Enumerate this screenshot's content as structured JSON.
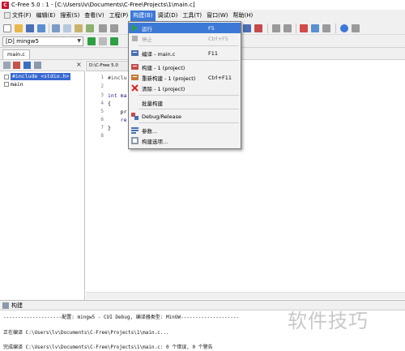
{
  "window": {
    "title": "C-Free 5.0 : 1 - [C:\\Users\\lv\\Documents\\C-Free\\Projects\\1\\main.c]"
  },
  "menubar": {
    "items": [
      "文件(F)",
      "编辑(E)",
      "搜索(S)",
      "查看(V)",
      "工程(P)",
      "构建(B)",
      "调试(D)",
      "工具(T)",
      "窗口(W)",
      "帮助(H)"
    ],
    "active": "构建(B)"
  },
  "toolbar": {
    "target": "[D] mingw5"
  },
  "file_tab": "main.c",
  "project_tree": {
    "items": [
      "#include <stdio.h>",
      "main"
    ]
  },
  "editor": {
    "tab_title": "D:\\C-Free 5.0",
    "line_numbers": [
      "1",
      "2",
      "3",
      "4",
      "5",
      "6",
      "7",
      "8"
    ],
    "lines": [
      "#inclu",
      "",
      "int ma",
      "{",
      "    pr",
      "    re",
      "}",
      ""
    ]
  },
  "build_menu": {
    "items": [
      {
        "label": "运行",
        "shortcut": "F5",
        "icon": "run-icon"
      },
      {
        "label": "停止",
        "shortcut": "Ctrl+F5",
        "icon": "stop-icon"
      },
      {
        "label": "编译 - main.c",
        "shortcut": "F11",
        "icon": "compile-icon"
      },
      {
        "label": "构建 - 1 (project)",
        "shortcut": "",
        "icon": "build-icon"
      },
      {
        "label": "重新构建 - 1 (project)",
        "shortcut": "Ctrl+F11",
        "icon": "rebuild-icon"
      },
      {
        "label": "清除 - 1 (project)",
        "shortcut": "",
        "icon": "clean-icon"
      },
      {
        "label": "批量构建",
        "shortcut": "",
        "icon": ""
      },
      {
        "label": "Debug/Release",
        "shortcut": "",
        "icon": "debug-release-icon"
      },
      {
        "label": "参数...",
        "shortcut": "",
        "icon": "params-icon"
      },
      {
        "label": "构建选项...",
        "shortcut": "",
        "icon": "build-options-icon"
      }
    ]
  },
  "build_panel": {
    "title": "构建",
    "lines": [
      "--------------------配置: mingw5 - CUI Debug, 编译器类型: MinGW--------------------",
      "",
      "正在编译 C:\\Users\\lv\\Documents\\C-Free\\Projects\\1\\main.c...",
      "",
      "完成编译 C:\\Users\\lv\\Documents\\C-Free\\Projects\\1\\main.c: 0 个错误, 0 个警告"
    ]
  },
  "watermark": "软件技巧",
  "colors": {
    "menu_highlight": "#3c79d6",
    "tree_selection": "#3869d0",
    "app_logo": "#c8102e"
  }
}
